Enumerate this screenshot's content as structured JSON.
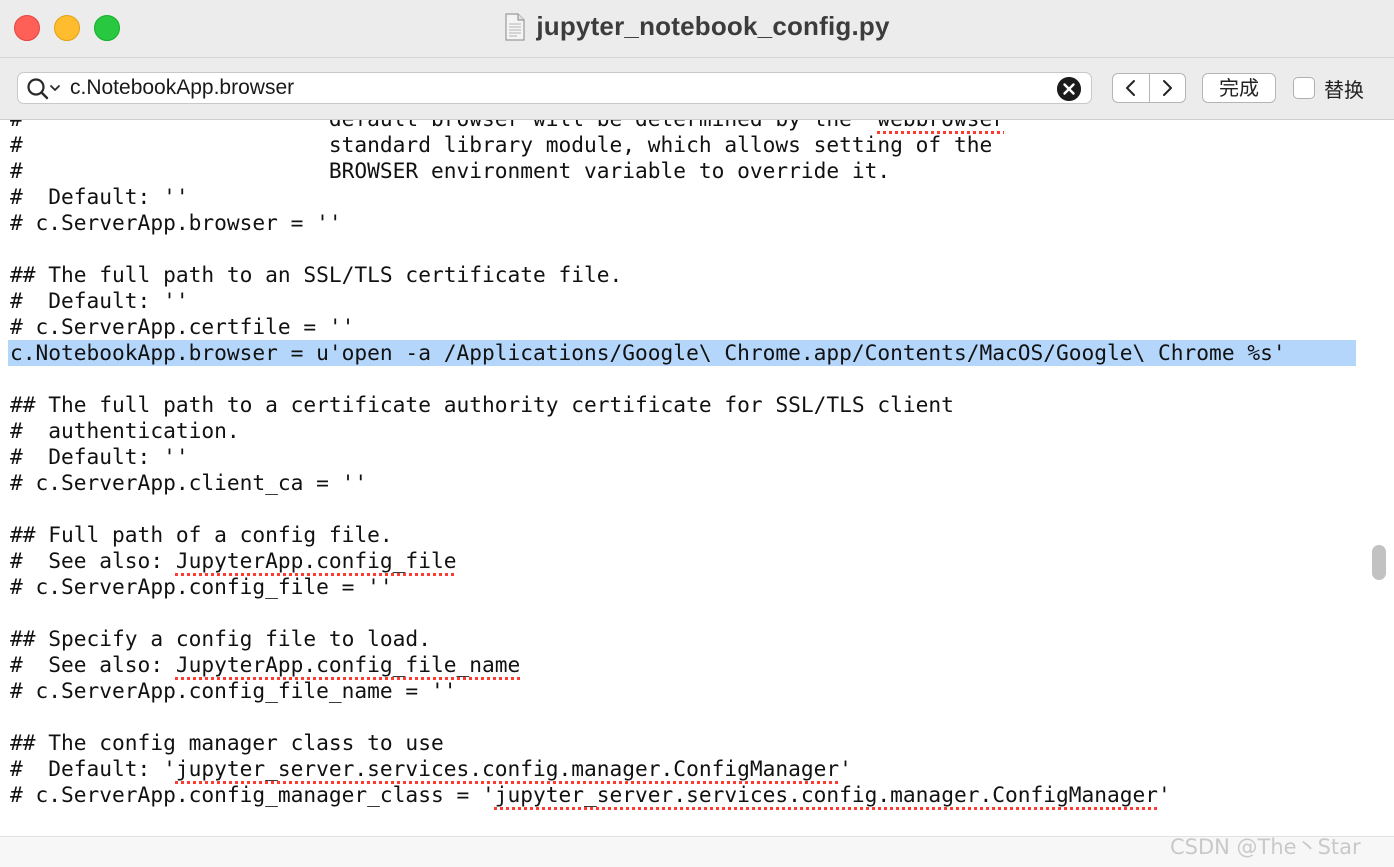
{
  "window": {
    "title": "jupyter_notebook_config.py",
    "title_icon": "document-icon"
  },
  "find_bar": {
    "search_value": "c.NotebookApp.browser",
    "done_label": "完成",
    "replace_label": "替换",
    "replace_checked": false
  },
  "editor": {
    "lines": [
      {
        "text": "#                        default browser will be determined by the `webbrowser`",
        "parts": [
          {
            "t": "#                        default browser will be determined by the `"
          },
          {
            "t": "webbrowser",
            "squiggle": true
          },
          {
            "t": "`"
          }
        ]
      },
      {
        "text": "#                        standard library module, which allows setting of the"
      },
      {
        "text": "#                        BROWSER environment variable to override it."
      },
      {
        "text": "#  Default: ''"
      },
      {
        "text": "# c.ServerApp.browser = ''"
      },
      {
        "text": ""
      },
      {
        "text": "## The full path to an SSL/TLS certificate file."
      },
      {
        "text": "#  Default: ''"
      },
      {
        "text": "# c.ServerApp.certfile = ''"
      },
      {
        "text": "c.NotebookApp.browser = u'open -a /Applications/Google\\ Chrome.app/Contents/MacOS/Google\\ Chrome %s'",
        "highlight": true
      },
      {
        "text": ""
      },
      {
        "text": "## The full path to a certificate authority certificate for SSL/TLS client"
      },
      {
        "text": "#  authentication."
      },
      {
        "text": "#  Default: ''"
      },
      {
        "text": "# c.ServerApp.client_ca = ''"
      },
      {
        "text": ""
      },
      {
        "text": "## Full path of a config file."
      },
      {
        "text": "#  See also: JupyterApp.config_file",
        "parts": [
          {
            "t": "#  See also: "
          },
          {
            "t": "JupyterApp.config_file",
            "squiggle": true
          }
        ]
      },
      {
        "text": "# c.ServerApp.config_file = ''"
      },
      {
        "text": ""
      },
      {
        "text": "## Specify a config file to load."
      },
      {
        "text": "#  See also: JupyterApp.config_file_name",
        "parts": [
          {
            "t": "#  See also: "
          },
          {
            "t": "JupyterApp.config_file_name",
            "squiggle": true
          }
        ]
      },
      {
        "text": "# c.ServerApp.config_file_name = ''"
      },
      {
        "text": ""
      },
      {
        "text": "## The config manager class to use"
      },
      {
        "text": "#  Default: 'jupyter_server.services.config.manager.ConfigManager'",
        "parts": [
          {
            "t": "#  Default: '"
          },
          {
            "t": "jupyter_server.services.config.manager.ConfigManager",
            "squiggle": true
          },
          {
            "t": "'"
          }
        ]
      },
      {
        "text": "# c.ServerApp.config_manager_class = 'jupyter_server.services.config.manager.ConfigManager'",
        "parts": [
          {
            "t": "# c.ServerApp.config_manager_class = '"
          },
          {
            "t": "jupyter_server.services.config.manager.ConfigManager",
            "squiggle": true
          },
          {
            "t": "'"
          }
        ]
      }
    ]
  },
  "watermark": "CSDN @The丶Star",
  "colors": {
    "selection_highlight": "#b4d6fb",
    "spell_squiggle": "#ff3b30",
    "close_button": "#fe5f57",
    "minimize_button": "#febc2e",
    "zoom_button": "#28c840"
  }
}
